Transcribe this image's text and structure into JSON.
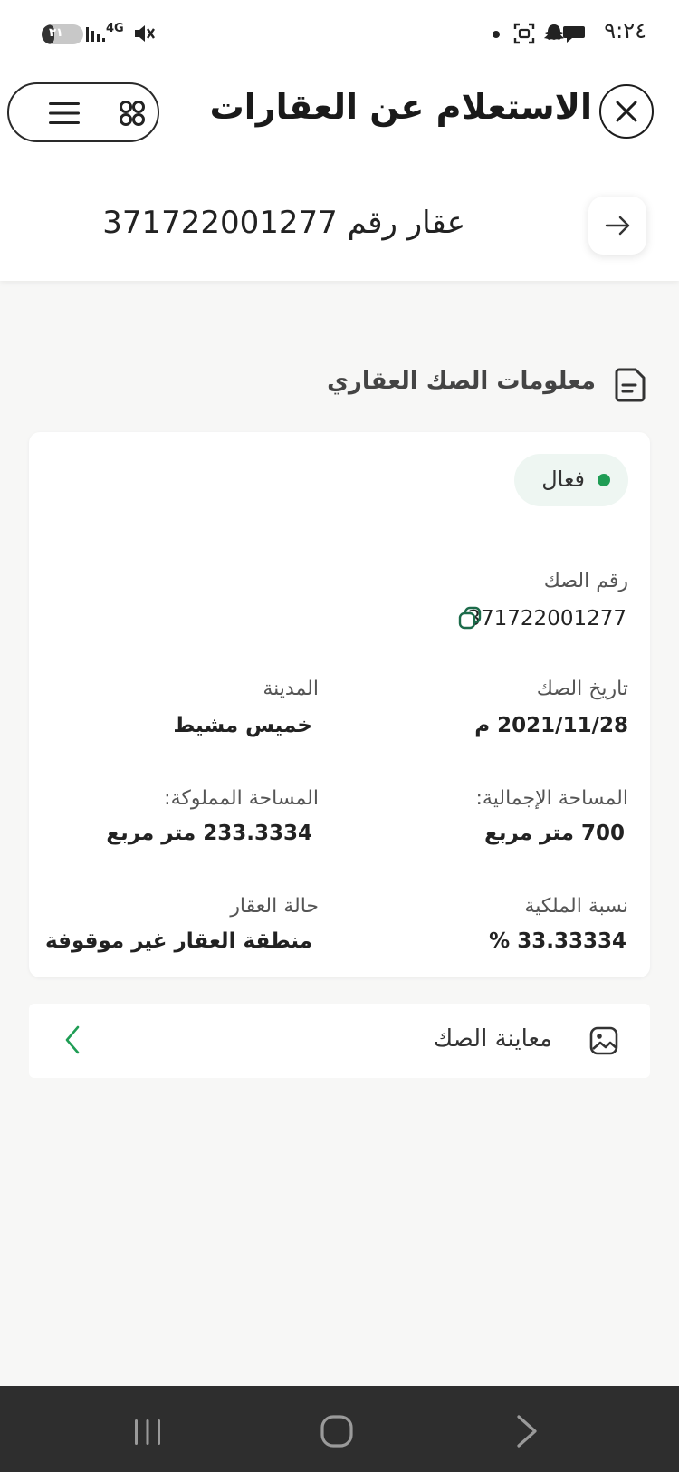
{
  "status_bar": {
    "time": "٩:٢٤",
    "battery_text": "٣١",
    "battery_level": 0.31,
    "network": "4G"
  },
  "header": {
    "title": "الاستعلام عن العقارات",
    "close_icon": "close-icon",
    "grid_icon": "apps-grid-icon",
    "menu_icon": "hamburger-menu-icon"
  },
  "property": {
    "title": "عقار رقم 371722001277",
    "back_icon": "arrow-right-icon"
  },
  "section": {
    "title": "معلومات الصك العقاري",
    "icon": "document-icon"
  },
  "card": {
    "status": {
      "label": "فعال",
      "color": "#1f9d55"
    },
    "deed_number": {
      "label": "رقم الصك",
      "value": "371722001277"
    },
    "deed_date": {
      "label": "تاريخ الصك",
      "value": "2021/11/28 م"
    },
    "city": {
      "label": "المدينة",
      "value": "خميس مشيط"
    },
    "total_area": {
      "label": "المساحة الإجمالية:",
      "value": "700 متر مربع"
    },
    "owned_area": {
      "label": "المساحة المملوكة:",
      "value": "233.3334 متر مربع"
    },
    "ownership_ratio": {
      "label": "نسبة الملكية",
      "value": "33.33334 %"
    },
    "property_status": {
      "label": "حالة العقار",
      "value": "منطقة العقار غير موقوفة"
    }
  },
  "preview": {
    "label": "معاينة الصك",
    "icon": "image-icon",
    "chevron_icon": "chevron-left-icon",
    "accent": "#1f9d55"
  }
}
